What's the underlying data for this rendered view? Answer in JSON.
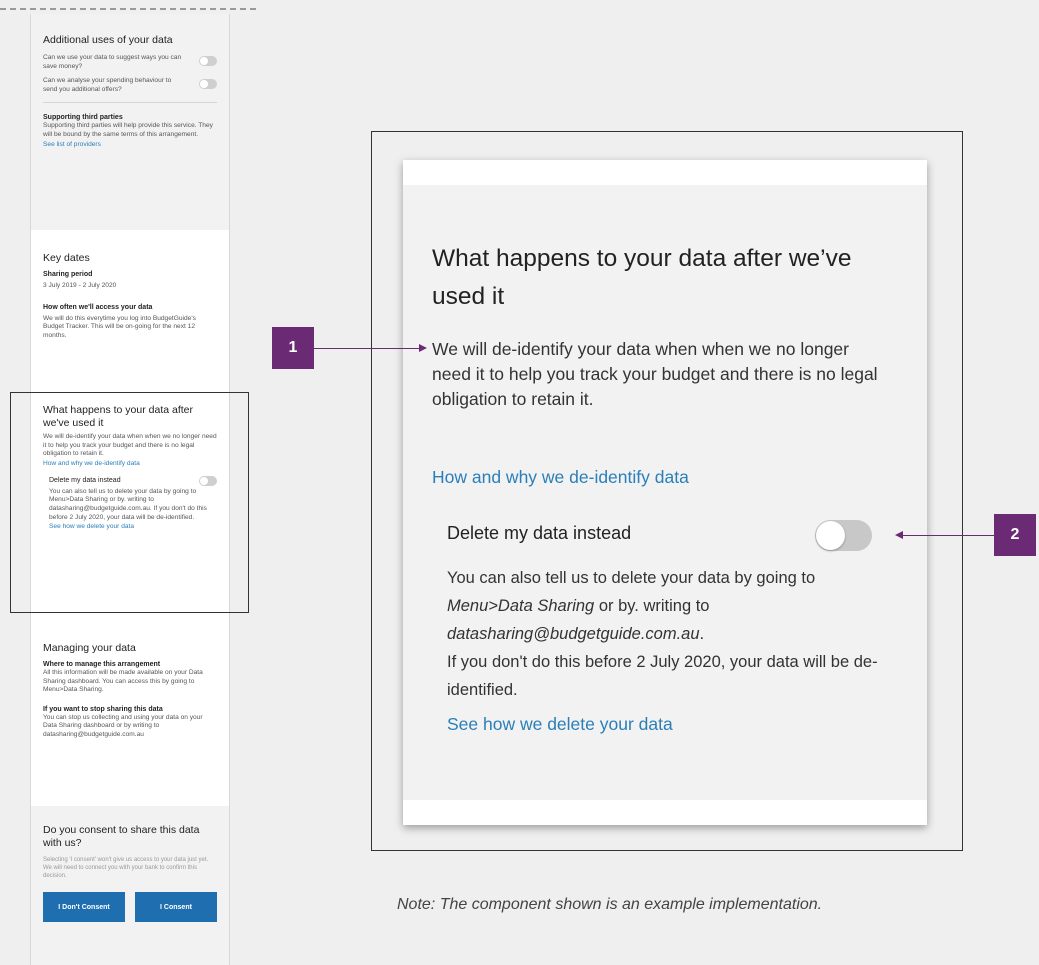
{
  "phone": {
    "additional": {
      "heading": "Additional uses of your data",
      "q1": "Can we use your data to suggest ways you can save money?",
      "q2": "Can we analyse your spending behaviour to send you additional offers?"
    },
    "third_parties": {
      "heading": "Supporting third parties",
      "text": "Supporting third parties will help provide this service. They will be bound by the same terms of this arrangement.",
      "link": "See list of providers"
    },
    "key_dates": {
      "heading": "Key dates",
      "period_label": "Sharing period",
      "period_value": "3 July 2019 - 2 July 2020",
      "access_label": "How often we'll access your data",
      "access_text": "We will do this everytime you log into BudgetGuide's Budget Tracker. This will be on-going for the next 12 months."
    },
    "what_happens": {
      "heading": "What happens to your data after we've used it",
      "text": "We will de-identify your data when when we no longer need it to help you track your budget and there is no legal obligation to retain it.",
      "link": "How and why we de-identify data",
      "delete_label": "Delete my data instead",
      "delete_text": "You can also tell us to delete your data by going to Menu>Data Sharing or by. writing to datasharing@budgetguide.com.au. If you don't do this before 2 July 2020, your data will be de-identified.",
      "delete_link": "See how we delete your data"
    },
    "managing": {
      "heading": "Managing your data",
      "where_label": "Where to manage this arrangement",
      "where_text": "All this information will be made available on your Data Sharing dashboard. You can access this by going to Menu>Data Sharing.",
      "stop_label": "If you want to stop sharing this data",
      "stop_text": "You can stop us collecting and using your data on your Data Sharing dashboard or by writing to datasharing@budgetguide.com.au"
    },
    "consent": {
      "heading": "Do you consent to share this data with us?",
      "text": "Selecting 'I consent' won't give us access to your data just yet. We will need to connect you with your bank to confirm this decision.",
      "decline": "I Don't Consent",
      "accept": "I Consent"
    }
  },
  "component": {
    "title": "What happens to your data after we’ve used it",
    "body": "We will de-identify your data when when we no longer need it to help you track your budget and there is no legal obligation to retain it.",
    "link": "How and why we de-identify data",
    "delete_heading": "Delete my data instead",
    "delete_line1": "You can also tell us to delete your data by going to ",
    "delete_menu": "Menu>Data Sharing",
    "delete_line2": " or by. writing to",
    "delete_email": "datasharing@budgetguide.com.au",
    "delete_period": ".",
    "delete_line3": "If you don't do this before 2 July 2020, your data will be de-identified.",
    "delete_link": "See how we delete your data",
    "toggle_on": false
  },
  "markers": {
    "m1": "1",
    "m2": "2"
  },
  "note": "Note: The component shown is an example implementation.",
  "colors": {
    "accent": "#6b2a74",
    "link": "#2a7fb8",
    "button": "#1f6fb0"
  }
}
